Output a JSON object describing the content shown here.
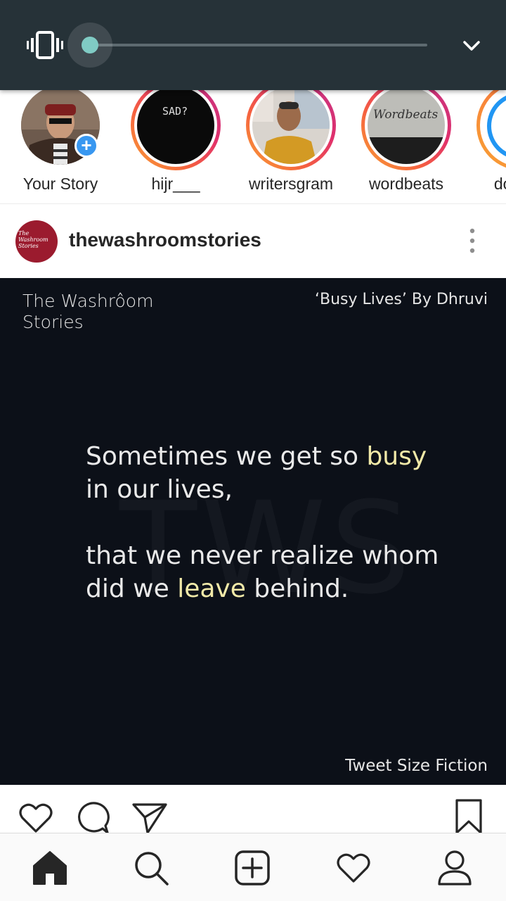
{
  "volume_panel": {
    "mode_icon": "vibrate-icon",
    "level": 0,
    "expand_icon": "chevron-down-icon",
    "colors": {
      "panel": "#263238",
      "thumb": "#80cbc4"
    }
  },
  "stories": [
    {
      "label": "Your Story",
      "has_add_badge": true
    },
    {
      "label": "hijr___",
      "avatar_text": "SAD?"
    },
    {
      "label": "writersgram"
    },
    {
      "label": "wordbeats",
      "avatar_text": "Wordbeats"
    },
    {
      "label": "do_"
    }
  ],
  "post": {
    "username": "thewashroomstories",
    "avatar_text": "The Washroom Stories",
    "image": {
      "brand_line1": "The Washrôom",
      "brand_line2": "Stories",
      "byline": "‘Busy Lives’ By Dhruvi",
      "watermark": "TWS",
      "quote": {
        "l1_a": "Sometimes we get so ",
        "l1_hl": "busy",
        "l2": "in our lives,",
        "l3": "that we never realize whom",
        "l4_a": "did we ",
        "l4_hl": "leave",
        "l4_b": " behind."
      },
      "footer": "Tweet Size Fiction"
    },
    "actions": [
      "heart-icon",
      "comment-icon",
      "share-icon",
      "bookmark-icon"
    ]
  },
  "bottom_nav": [
    "home-icon",
    "search-icon",
    "add-post-icon",
    "activity-heart-icon",
    "profile-icon"
  ]
}
